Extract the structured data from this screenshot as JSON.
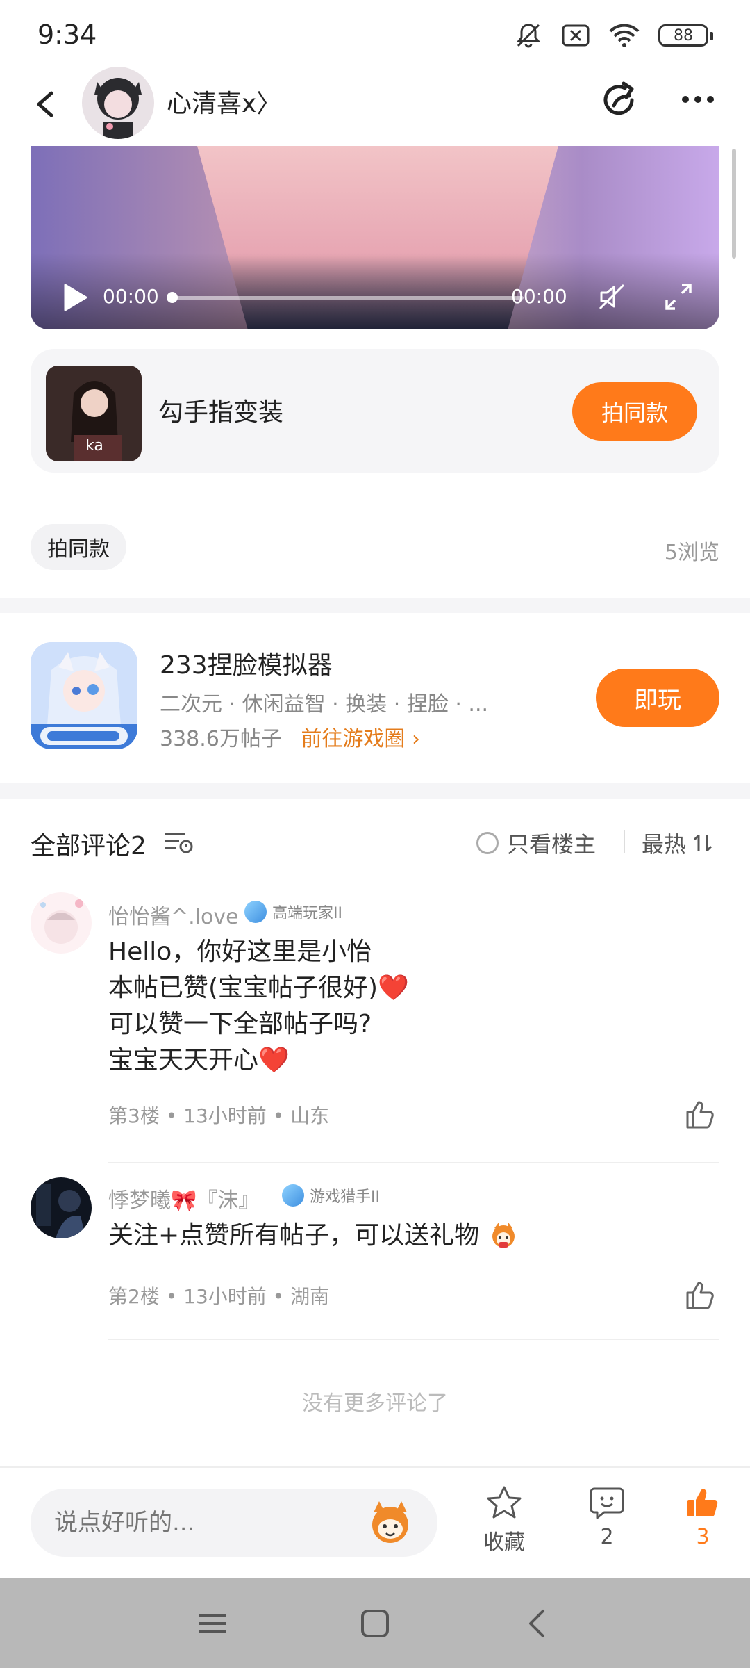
{
  "status_bar": {
    "time": "9:34",
    "battery": "88"
  },
  "header": {
    "username": "心清喜x〉"
  },
  "video": {
    "current_time": "00:00",
    "duration": "00:00",
    "progress": 0
  },
  "same_style": {
    "title": "勾手指变装",
    "button": "拍同款"
  },
  "post_meta": {
    "tag": "拍同款",
    "views": "5浏览"
  },
  "game": {
    "title": "233捏脸模拟器",
    "tags": "二次元 · 休闲益智 · 换装 · 捏脸 · ...",
    "posts": "338.6万帖子",
    "link": "前往游戏圈 ›",
    "play_button": "即玩"
  },
  "comments": {
    "title": "全部评论2",
    "only_owner": "只看楼主",
    "sort": "最热",
    "items": [
      {
        "name": "怡怡酱^.love",
        "badge": "高端玩家II",
        "lines": [
          "Hello，你好这里是小怡",
          "本帖已赞(宝宝帖子很好)❤️",
          "可以赞一下全部帖子吗?",
          "宝宝天天开心❤️"
        ],
        "meta": "第3楼 • 13小时前 • 山东"
      },
      {
        "name": "悸梦曦🎀『沫』",
        "badge": "游戏猎手II",
        "lines": [
          "关注+点赞所有帖子，可以送礼物"
        ],
        "meta": "第2楼 • 13小时前 • 湖南"
      }
    ],
    "no_more": "没有更多评论了"
  },
  "bottom_bar": {
    "input_placeholder": "说点好听的...",
    "favorite_label": "收藏",
    "comment_count": "2",
    "like_count": "3"
  },
  "colors": {
    "accent": "#ff7a1a",
    "link": "#e47c1c"
  }
}
